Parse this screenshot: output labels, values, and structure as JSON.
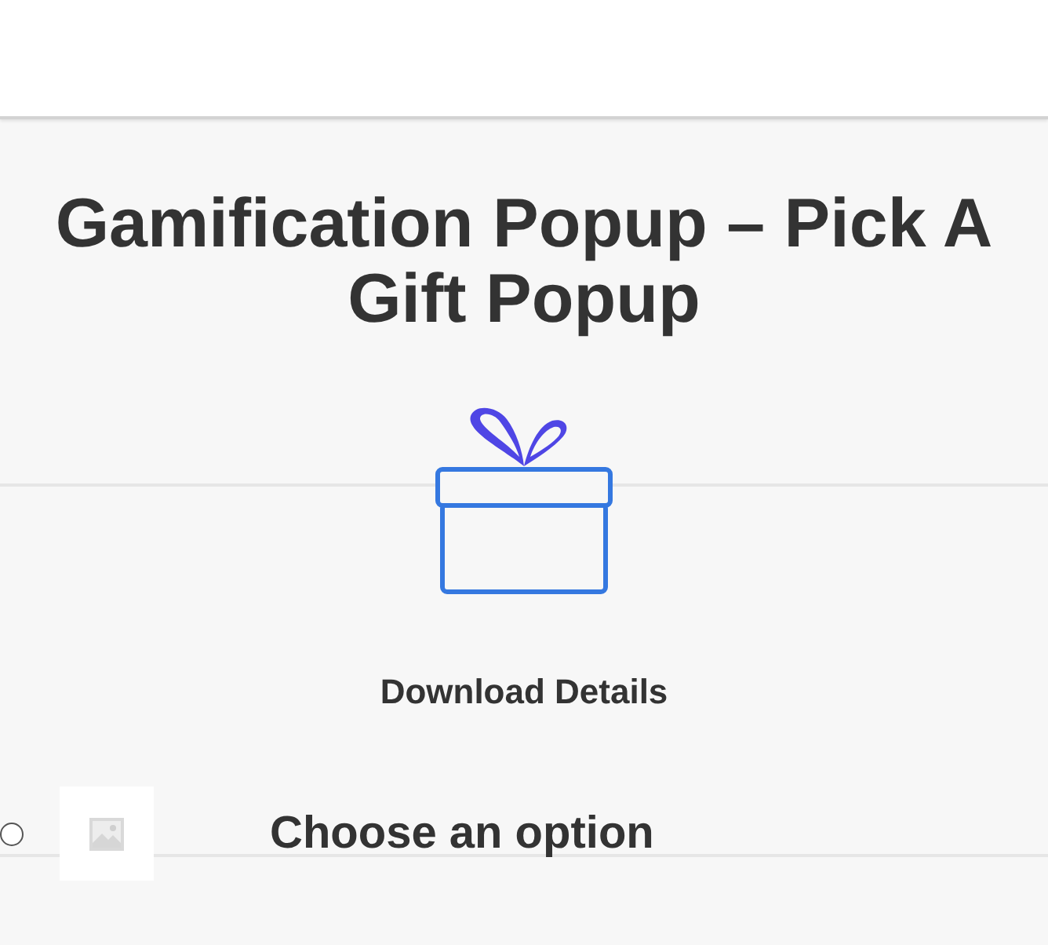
{
  "page": {
    "title": "Gamification Popup – Pick A Gift Popup"
  },
  "download": {
    "label": "Download Details"
  },
  "variation": {
    "selected": false,
    "label": "Choose an option"
  }
}
